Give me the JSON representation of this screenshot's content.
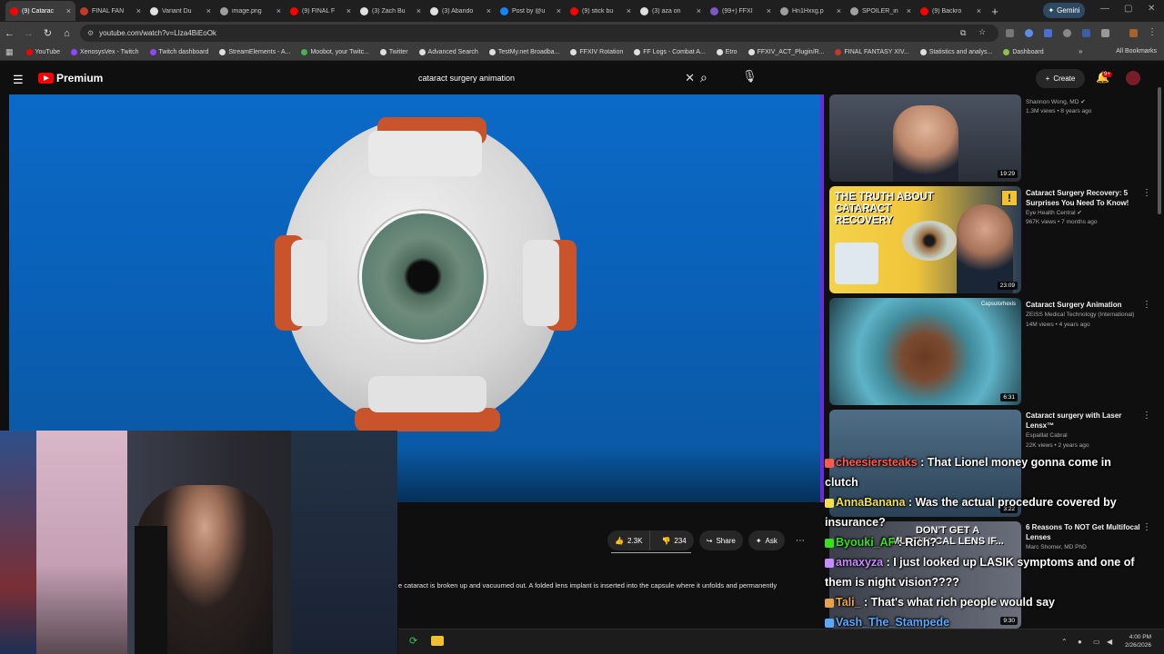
{
  "tabs": [
    {
      "label": "(9) Catarac",
      "color": "#ff0000",
      "active": true
    },
    {
      "label": "FINAL FAN",
      "color": "#c0392b"
    },
    {
      "label": "Variant Du",
      "color": "#e0e0e0"
    },
    {
      "label": "image.png",
      "color": "#9e9e9e"
    },
    {
      "label": "(9) FINAL F",
      "color": "#ff0000"
    },
    {
      "label": "(3) Zach Bu",
      "color": "#e0e0e0"
    },
    {
      "label": "(3) Abando",
      "color": "#e0e0e0"
    },
    {
      "label": "Post by @u",
      "color": "#1185fe"
    },
    {
      "label": "(9) stick bu",
      "color": "#ff0000"
    },
    {
      "label": "(3) aza on",
      "color": "#e0e0e0"
    },
    {
      "label": "(99+) FFXI",
      "color": "#7e57c2"
    },
    {
      "label": "Hn1Hxxg.p",
      "color": "#9e9e9e"
    },
    {
      "label": "SPOILER_in",
      "color": "#9e9e9e"
    },
    {
      "label": "(9) Backro",
      "color": "#ff0000"
    }
  ],
  "gemini_label": "Gemini",
  "url": "youtube.com/watch?v=LIza4BiEoOk",
  "bookmarks": [
    {
      "label": "YouTube",
      "color": "#ff0000"
    },
    {
      "label": "XenosysVex - Twitch",
      "color": "#9146ff"
    },
    {
      "label": "Twitch dashboard",
      "color": "#9146ff"
    },
    {
      "label": "StreamElements - A...",
      "color": "#e0e0e0"
    },
    {
      "label": "Moobot, your Twitc...",
      "color": "#4caf50"
    },
    {
      "label": "Twitter",
      "color": "#e0e0e0"
    },
    {
      "label": "Advanced Search",
      "color": "#e0e0e0"
    },
    {
      "label": "TestMy.net Broadba...",
      "color": "#e0e0e0"
    },
    {
      "label": "FFXIV Rotation",
      "color": "#e0e0e0"
    },
    {
      "label": "FF Logs - Combat A...",
      "color": "#e0e0e0"
    },
    {
      "label": "Etro",
      "color": "#e0e0e0"
    },
    {
      "label": "FFXIV_ACT_Plugin/R...",
      "color": "#e0e0e0"
    },
    {
      "label": "FINAL FANTASY XIV...",
      "color": "#c0392b"
    },
    {
      "label": "Statistics and analys...",
      "color": "#e0e0e0"
    },
    {
      "label": "Dashboard",
      "color": "#8bc34a"
    }
  ],
  "all_bookmarks": "All Bookmarks",
  "yt": {
    "logo": "Premium",
    "search_value": "cataract surgery animation",
    "create": "Create",
    "notif_count": "9+"
  },
  "actions": {
    "likes": "2.3K",
    "dislikes": "234",
    "share": "Share",
    "ask": "Ask"
  },
  "description": "e cataract is broken up and vacuumed out. A folded lens implant is inserted into the capsule where it unfolds and permanently",
  "sidebar": [
    {
      "title": "",
      "channel": "Shannon Wong, MD",
      "meta": "1.3M views • 8 years ago",
      "duration": "19:29",
      "verified": true
    },
    {
      "title": "Cataract Surgery Recovery: 5 Surprises You Need To Know!",
      "channel": "Eye Health Central",
      "meta": "967K views • 7 months ago",
      "duration": "23:09",
      "verified": true,
      "thumb_text": "THE TRUTH ABOUT CATARACT RECOVERY"
    },
    {
      "title": "Cataract Surgery Animation",
      "channel": "ZEISS Medical Technology (International)",
      "meta": "14M views • 4 years ago",
      "duration": "6:31",
      "thumb_text": "Capsulorhexis"
    },
    {
      "title": "Cataract surgery with Laser Lensx™",
      "channel": "Espaillat Cabral",
      "meta": "22K views • 2 years ago",
      "duration": "3:22"
    },
    {
      "title": "6 Reasons To NOT Get Multifocal Lenses",
      "channel": "Marc Shomer, MD PhD",
      "meta": "",
      "duration": "9:30",
      "thumb_text": "DON'T GET A MULTIFOCAL LENS IF..."
    }
  ],
  "chat": [
    {
      "user": "cheesiersteaks",
      "color": "#ff5a4a",
      "text": " : That Lionel money gonna come in clutch"
    },
    {
      "user": "AnnaBanana",
      "color": "#f2e14b",
      "text": " : Was the actual procedure covered by insurance?"
    },
    {
      "user": "Byouki_AF",
      "color": "#39e01b",
      "text": " : Rich?"
    },
    {
      "user": "amaxyza",
      "color": "#c98cff",
      "text": " : I just looked up LASIK symptoms and one of them is night vision????"
    },
    {
      "user": "Tali_",
      "color": "#e8a24a",
      "text": " : That's what rich people would say"
    },
    {
      "user": "Vash_The_Stampede",
      "color": "#5aa9ff",
      "text": ""
    }
  ],
  "clock": {
    "time": "4:00 PM",
    "date": "2/26/2026"
  },
  "icons": {
    "search": "search-icon",
    "mic": "mic-icon",
    "bell": "bell-icon",
    "like": "thumbs-up-icon",
    "dislike": "thumbs-down-icon",
    "share": "share-icon",
    "ask": "sparkle-icon"
  }
}
